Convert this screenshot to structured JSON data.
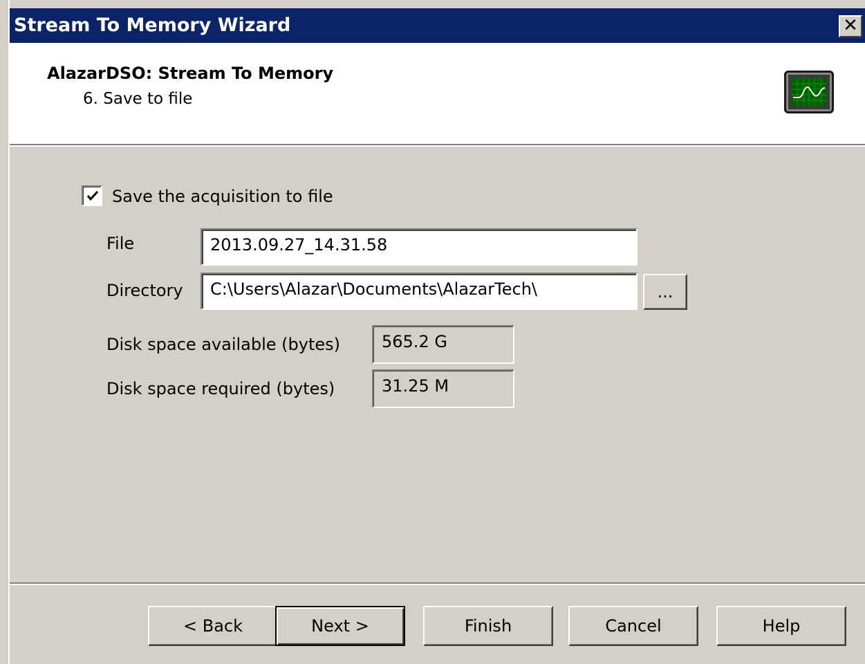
{
  "window": {
    "title": "Stream To Memory Wizard",
    "close_glyph": "✕"
  },
  "header": {
    "title": "AlazarDSO: Stream To Memory",
    "step": "6. Save to file",
    "icon": "oscilloscope-icon"
  },
  "form": {
    "save_checkbox": {
      "label": "Save the acquisition to file",
      "checked": true
    },
    "file": {
      "label": "File",
      "value": "2013.09.27_14.31.58"
    },
    "directory": {
      "label": "Directory",
      "value": "C:\\Users\\Alazar\\Documents\\AlazarTech\\",
      "browse_label": "..."
    },
    "disk_available": {
      "label": "Disk space available (bytes)",
      "value": "565.2 G"
    },
    "disk_required": {
      "label": "Disk space required (bytes)",
      "value": "31.25 M"
    }
  },
  "buttons": {
    "back": "< Back",
    "next": "Next >",
    "finish": "Finish",
    "cancel": "Cancel",
    "help": "Help"
  },
  "colors": {
    "titlebar": "#0a246a",
    "face": "#d4d0c8",
    "scope_grid": "#00a000"
  }
}
